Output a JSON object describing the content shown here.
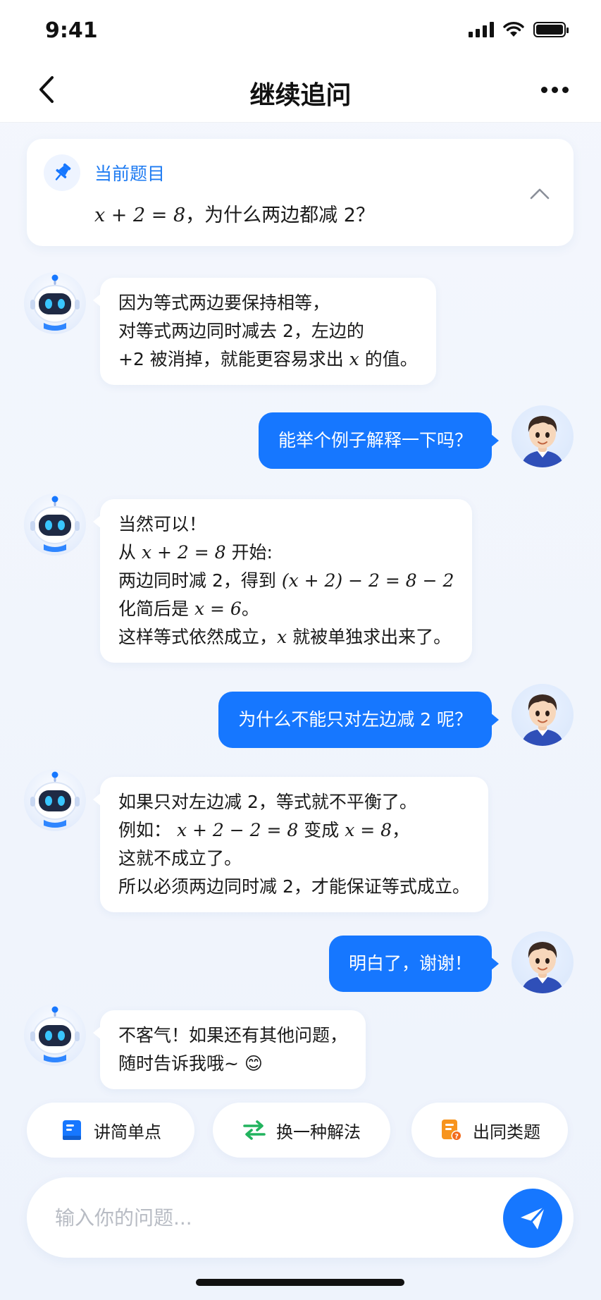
{
  "status_bar": {
    "time": "9:41"
  },
  "nav": {
    "title": "继续追问"
  },
  "question": {
    "label": "当前题目",
    "math": "x + 2 = 8",
    "text": "，为什么两边都减 2？"
  },
  "messages": [
    {
      "role": "bot",
      "lines": [
        [
          "因为等式两边要保持相等，"
        ],
        [
          "对等式两边同时减去 2，左边的"
        ],
        [
          "+2 被消掉，就能更容易求出 ",
          {
            "m": "x"
          },
          " 的值。"
        ]
      ]
    },
    {
      "role": "user",
      "text": "能举个例子解释一下吗？"
    },
    {
      "role": "bot",
      "lines": [
        [
          "当然可以！"
        ],
        [
          "从 ",
          {
            "m": "x + 2 = 8"
          },
          " 开始:"
        ],
        [
          "两边同时减 2，得到 ",
          {
            "m": "(x + 2) − 2 = 8 − 2"
          }
        ],
        [
          "化简后是 ",
          {
            "m": "x = 6"
          },
          "。"
        ],
        [
          "这样等式依然成立，",
          {
            "m": "x"
          },
          " 就被单独求出来了。"
        ]
      ]
    },
    {
      "role": "user",
      "text": "为什么不能只对左边减 2 呢？"
    },
    {
      "role": "bot",
      "lines": [
        [
          "如果只对左边减 2，等式就不平衡了。"
        ],
        [
          "例如： ",
          {
            "m": "x + 2 − 2 = 8"
          },
          " 变成 ",
          {
            "m": "x = 8"
          },
          "，"
        ],
        [
          "这就不成立了。"
        ],
        [
          "所以必须两边同时减 2，才能保证等式成立。"
        ]
      ]
    },
    {
      "role": "user",
      "text": "明白了，谢谢！"
    },
    {
      "role": "bot",
      "lines": [
        [
          "不客气！如果还有其他问题，"
        ],
        [
          "随时告诉我哦~ 😊"
        ]
      ]
    }
  ],
  "quick_actions": [
    {
      "label": "讲简单点",
      "icon": "book-icon"
    },
    {
      "label": "换一种解法",
      "icon": "swap-icon"
    },
    {
      "label": "出同类题",
      "icon": "worksheet-icon"
    }
  ],
  "input": {
    "placeholder": "输入你的问题..."
  },
  "colors": {
    "accent": "#1677ff",
    "accent_text": "#1e7bf2",
    "green": "#22b35e",
    "orange": "#f7941d"
  }
}
